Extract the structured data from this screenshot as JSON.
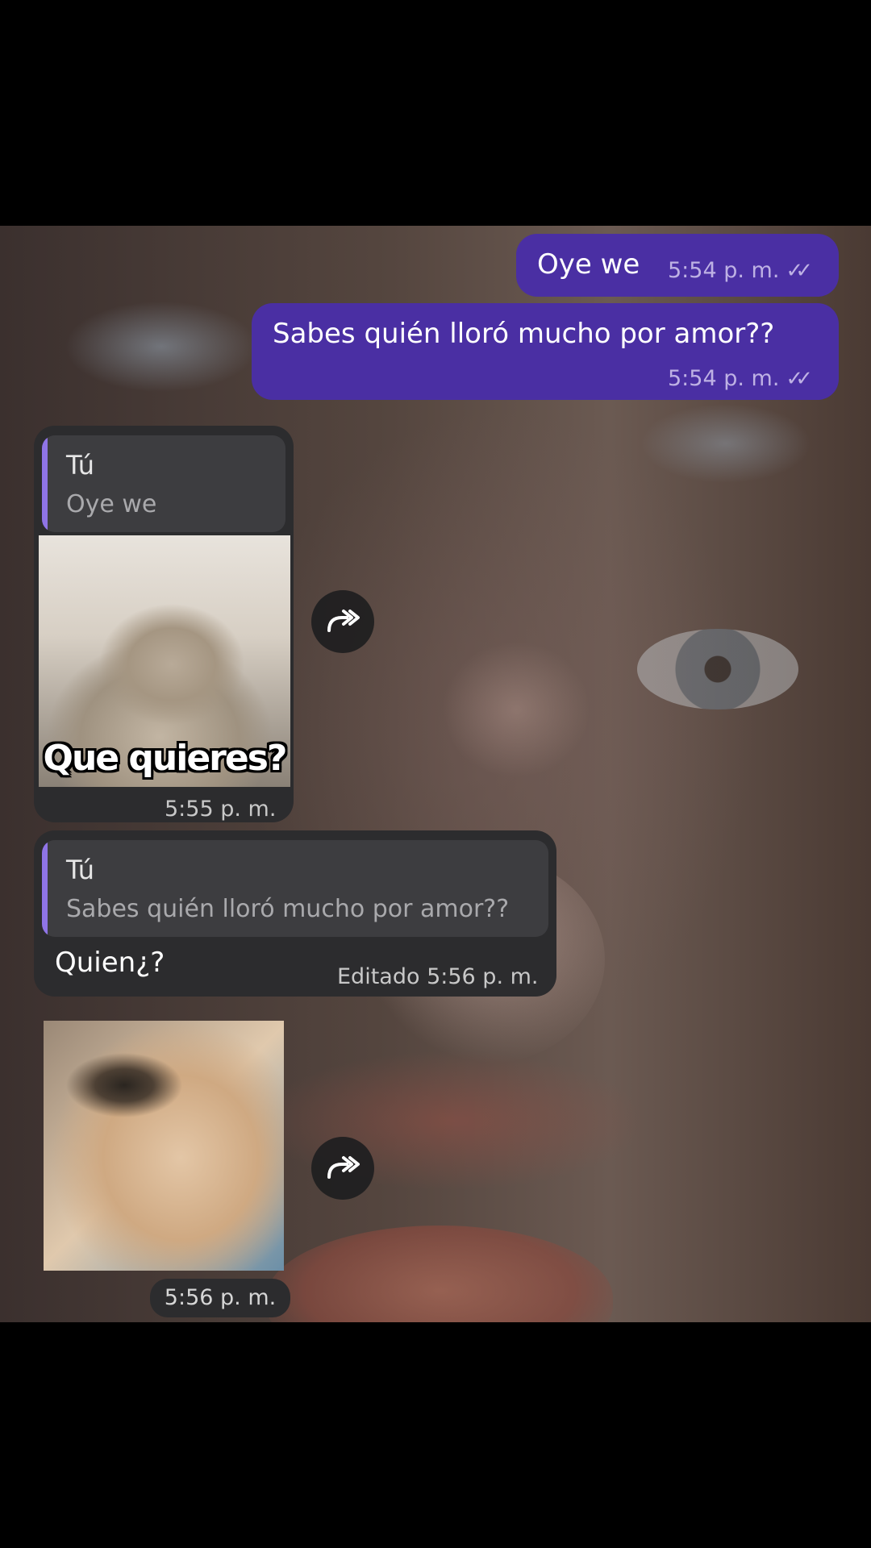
{
  "messages": {
    "m1": {
      "text": "Oye we",
      "time": "5:54 p. m."
    },
    "m2": {
      "text": "Sabes quién lloró mucho por amor??",
      "time": "5:54 p. m."
    },
    "m3": {
      "reply_author": "Tú",
      "reply_text": "Oye we",
      "sticker_caption": "Que quieres?",
      "time": "5:55 p. m."
    },
    "m4": {
      "reply_author": "Tú",
      "reply_text": "Sabes quién lloró mucho por amor??",
      "text": "Quien¿?",
      "edited_label": "Editado",
      "time": "5:56 p. m."
    },
    "m5": {
      "time": "5:56 p. m."
    }
  },
  "colors": {
    "outgoing_bubble": "#4a2fa3",
    "incoming_bubble": "#2c2c2e",
    "reply_accent": "#8f74e6"
  },
  "icons": {
    "read_receipt": "double-check-icon",
    "forward": "forward-arrow-icon"
  }
}
